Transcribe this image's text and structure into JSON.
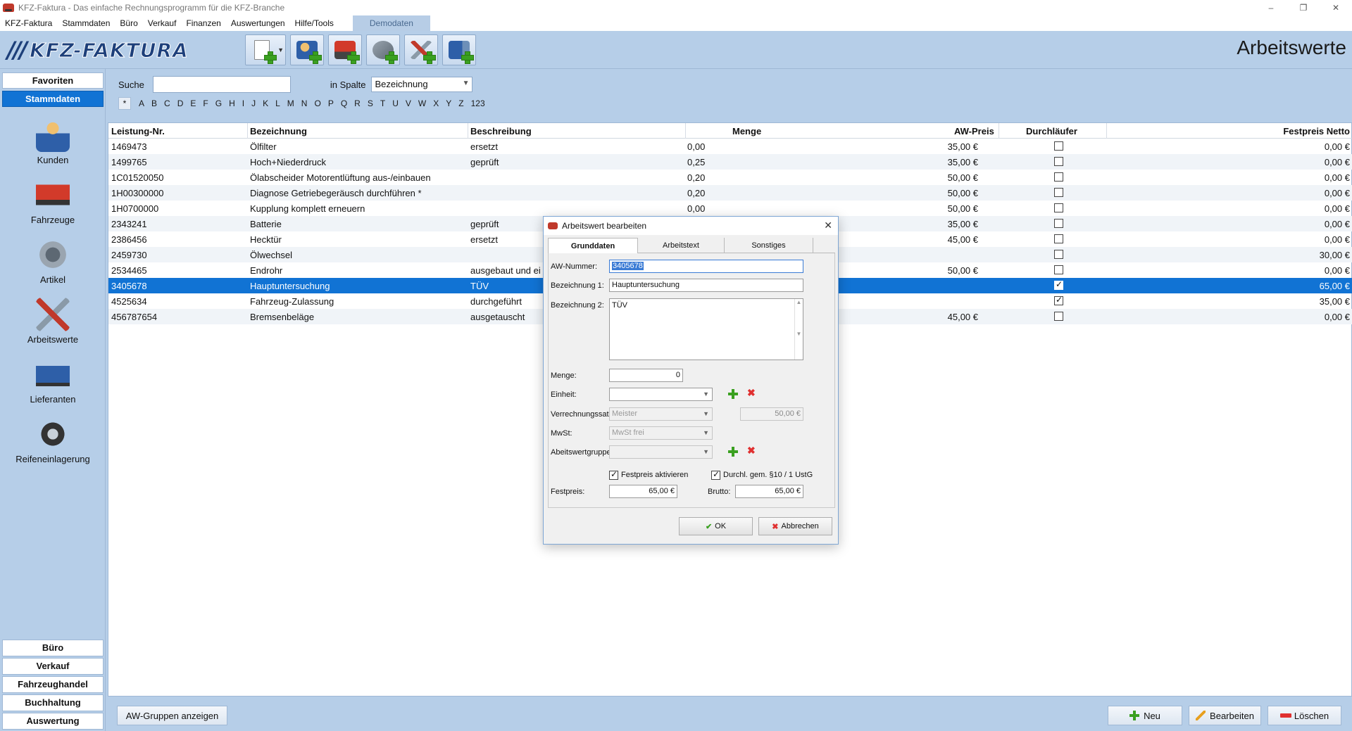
{
  "window": {
    "title": "KFZ-Faktura - Das einfache Rechnungsprogramm für die KFZ-Branche",
    "controls": [
      "–",
      "❐",
      "✕"
    ]
  },
  "menu": {
    "items": [
      "KFZ-Faktura",
      "Stammdaten",
      "Büro",
      "Verkauf",
      "Finanzen",
      "Auswertungen",
      "Hilfe/Tools"
    ],
    "demo": "Demodaten"
  },
  "header": {
    "logo_slashes": "///",
    "logo_text": "KFZ-FAKTURA",
    "page_title": "Arbeitswerte"
  },
  "toolbar": {
    "icons": [
      "new-document-icon",
      "add-customer-icon",
      "add-vehicle-icon",
      "add-article-icon",
      "add-work-value-icon",
      "add-supplier-icon"
    ]
  },
  "sidebar": {
    "tabs": [
      "Favoriten",
      "Stammdaten"
    ],
    "items": [
      "Kunden",
      "Fahrzeuge",
      "Artikel",
      "Arbeitswerte",
      "Lieferanten",
      "Reifeneinlagerung"
    ],
    "bottom": [
      "Büro",
      "Verkauf",
      "Fahrzeughandel",
      "Buchhaltung",
      "Auswertung"
    ]
  },
  "search": {
    "label": "Suche",
    "value": "",
    "column_label": "in Spalte",
    "column_value": "Bezeichnung"
  },
  "alphabet": [
    "*",
    "A",
    "B",
    "C",
    "D",
    "E",
    "F",
    "G",
    "H",
    "I",
    "J",
    "K",
    "L",
    "M",
    "N",
    "O",
    "P",
    "Q",
    "R",
    "S",
    "T",
    "U",
    "V",
    "W",
    "X",
    "Y",
    "Z",
    "123"
  ],
  "table": {
    "columns": [
      "Leistung-Nr.",
      "Bezeichnung",
      "Beschreibung",
      "Menge",
      "AW-Preis",
      "Durchläufer",
      "Festpreis Netto"
    ],
    "rows": [
      {
        "nr": "1469473",
        "bez": "Ölfilter",
        "beschr": "ersetzt",
        "menge": "0,00",
        "preis": "35,00 €",
        "dl": false,
        "fest": "0,00 €"
      },
      {
        "nr": "1499765",
        "bez": "Hoch+Niederdruck",
        "beschr": "geprüft",
        "menge": "0,25",
        "preis": "35,00 €",
        "dl": false,
        "fest": "0,00 €"
      },
      {
        "nr": "1C01520050",
        "bez": "Ölabscheider Motorentlüftung aus-/einbauen",
        "beschr": "",
        "menge": "0,20",
        "preis": "50,00 €",
        "dl": false,
        "fest": "0,00 €"
      },
      {
        "nr": "1H00300000",
        "bez": "Diagnose Getriebegeräusch durchführen *",
        "beschr": "",
        "menge": "0,20",
        "preis": "50,00 €",
        "dl": false,
        "fest": "0,00 €"
      },
      {
        "nr": "1H0700000",
        "bez": "Kupplung komplett erneuern",
        "beschr": "",
        "menge": "0,00",
        "preis": "50,00 €",
        "dl": false,
        "fest": "0,00 €"
      },
      {
        "nr": "2343241",
        "bez": "Batterie",
        "beschr": "geprüft",
        "menge": "",
        "preis": "35,00 €",
        "dl": false,
        "fest": "0,00 €"
      },
      {
        "nr": "2386456",
        "bez": "Hecktür",
        "beschr": "ersetzt",
        "menge": "",
        "preis": "45,00 €",
        "dl": false,
        "fest": "0,00 €"
      },
      {
        "nr": "2459730",
        "bez": "Ölwechsel",
        "beschr": "",
        "menge": "",
        "preis": "",
        "dl": false,
        "fest": "30,00 €"
      },
      {
        "nr": "2534465",
        "bez": "Endrohr",
        "beschr": "ausgebaut und ei",
        "menge": "",
        "preis": "50,00 €",
        "dl": false,
        "fest": "0,00 €"
      },
      {
        "nr": "3405678",
        "bez": "Hauptuntersuchung",
        "beschr": "TÜV",
        "menge": "",
        "preis": "",
        "dl": true,
        "fest": "65,00 €"
      },
      {
        "nr": "4525634",
        "bez": "Fahrzeug-Zulassung",
        "beschr": "durchgeführt",
        "menge": "",
        "preis": "",
        "dl": true,
        "fest": "35,00 €"
      },
      {
        "nr": "456787654",
        "bez": "Bremsenbeläge",
        "beschr": "ausgetauscht",
        "menge": "",
        "preis": "45,00 €",
        "dl": false,
        "fest": "0,00 €"
      }
    ],
    "selected_index": 9
  },
  "bottom_buttons": {
    "groups": "AW-Gruppen anzeigen",
    "new": "Neu",
    "edit": "Bearbeiten",
    "delete": "Löschen"
  },
  "dialog": {
    "title": "Arbeitswert bearbeiten",
    "tabs": [
      "Grunddaten",
      "Arbeitstext",
      "Sonstiges"
    ],
    "labels": {
      "aw_nummer": "AW-Nummer:",
      "bez1": "Bezeichnung 1:",
      "bez2": "Bezeichnung 2:",
      "menge": "Menge:",
      "einheit": "Einheit:",
      "verrechnung": "Verrechnungssatz:",
      "mwst": "MwSt:",
      "gruppe": "Abeitswertgruppe:",
      "festpreis_aktiv": "Festpreis aktivieren",
      "durchlaeufer": "Durchl. gem. §10 / 1 UstG",
      "festpreis": "Festpreis:",
      "brutto": "Brutto:"
    },
    "values": {
      "aw_nummer": "3405678",
      "bez1": "Hauptuntersuchung",
      "bez2": "TÜV",
      "menge": "0",
      "einheit": "",
      "verrechnung": "Meister",
      "verrechnung_preis": "50,00 €",
      "mwst": "MwSt frei",
      "gruppe": "",
      "festpreis_aktiv": true,
      "durchlaeufer": true,
      "festpreis": "65,00 €",
      "brutto": "65,00 €"
    },
    "buttons": {
      "ok": "OK",
      "cancel": "Abbrechen"
    }
  }
}
